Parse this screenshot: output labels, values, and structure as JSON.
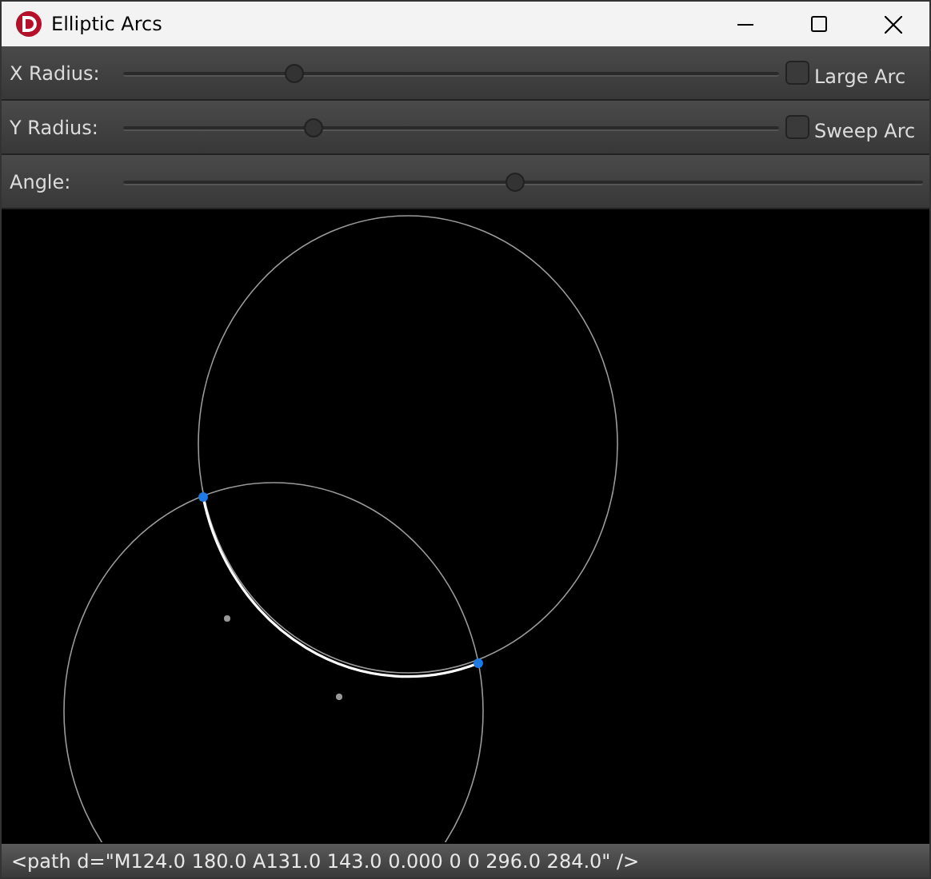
{
  "window": {
    "title": "Elliptic Arcs"
  },
  "controls": [
    {
      "label": "X Radius:",
      "level": 0.26,
      "checkbox": {
        "label": "Large Arc",
        "checked": false
      }
    },
    {
      "label": "Y Radius:",
      "level": 0.29,
      "checkbox": {
        "label": "Sweep Arc",
        "checked": false
      }
    },
    {
      "label": "Angle:",
      "level": 0.49
    }
  ],
  "status_bar": "<path d=\"M124.0 180.0 A131.0 143.0 0.000 0 0 296.0 284.0\" />"
}
